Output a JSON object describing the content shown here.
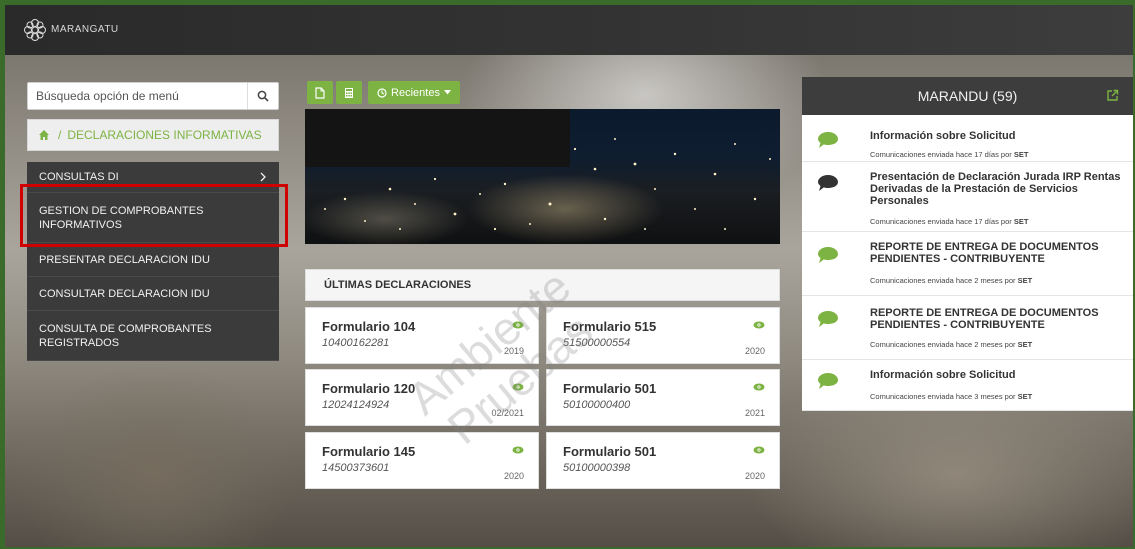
{
  "header": {
    "brand": "MARANGATU"
  },
  "sidebar": {
    "search": {
      "placeholder": "Búsqueda opción de menú"
    },
    "breadcrumb": {
      "separator": "/",
      "current": "DECLARACIONES INFORMATIVAS"
    },
    "items": [
      {
        "label": "CONSULTAS DI",
        "has_submenu": true
      },
      {
        "label": "GESTION DE COMPROBANTES INFORMATIVOS",
        "highlighted": true
      },
      {
        "label": "PRESENTAR DECLARACION IDU"
      },
      {
        "label": "CONSULTAR DECLARACION IDU"
      },
      {
        "label": "CONSULTA DE COMPROBANTES REGISTRADOS"
      }
    ]
  },
  "toolbar": {
    "recent_label": "Recientes"
  },
  "declarations": {
    "title": "ÚLTIMAS DECLARACIONES",
    "cards": [
      {
        "name": "Formulario 104",
        "number": "10400162281",
        "period": "2019"
      },
      {
        "name": "Formulario 515",
        "number": "51500000554",
        "period": "2020"
      },
      {
        "name": "Formulario 120",
        "number": "12024124924",
        "period": "02/2021"
      },
      {
        "name": "Formulario 501",
        "number": "50100000400",
        "period": "2021"
      },
      {
        "name": "Formulario 145",
        "number": "14500373601",
        "period": "2020"
      },
      {
        "name": "Formulario 501",
        "number": "50100000398",
        "period": "2020"
      }
    ]
  },
  "watermark": {
    "line1": "Ambiente",
    "line2": "Pruebas"
  },
  "marandu": {
    "title": "MARANDU (59)",
    "messages": [
      {
        "title": "Información sobre Solicitud",
        "meta": "Comunicaciones enviada hace 17 días por ",
        "sender": "SET",
        "bubble_color": "#7cb342"
      },
      {
        "title": "Presentación de Declaración Jurada IRP Rentas Derivadas de la Prestación de Servicios Personales",
        "meta": "Comunicaciones enviada hace 17 días por ",
        "sender": "SET",
        "bubble_color": "#333333"
      },
      {
        "title": "REPORTE DE ENTREGA DE DOCUMENTOS PENDIENTES - CONTRIBUYENTE",
        "meta": "Comunicaciones enviada hace 2 meses por ",
        "sender": "SET",
        "bubble_color": "#7cb342"
      },
      {
        "title": "REPORTE DE ENTREGA DE DOCUMENTOS PENDIENTES - CONTRIBUYENTE",
        "meta": "Comunicaciones enviada hace 2 meses por ",
        "sender": "SET",
        "bubble_color": "#7cb342"
      },
      {
        "title": "Información sobre Solicitud",
        "meta": "Comunicaciones enviada hace 3 meses por ",
        "sender": "SET",
        "bubble_color": "#7cb342"
      }
    ]
  },
  "colors": {
    "accent": "#7cb342",
    "highlight_border": "#d00000",
    "sidebar_bg": "#3b3b3b",
    "panel_header_bg": "#3d3d3d"
  }
}
